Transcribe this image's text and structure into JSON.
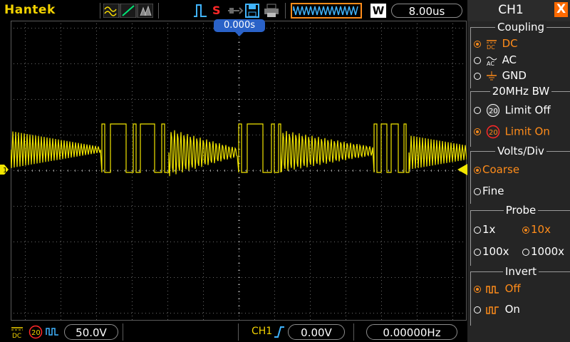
{
  "topbar": {
    "brand": "Hantek",
    "trigger_status": "S",
    "wave_mode_badge": "W",
    "timebase": "8.00us"
  },
  "scope": {
    "trigger_position": "0.000s",
    "channel_marker": "1",
    "trace_color": "#f2e600"
  },
  "bottombar": {
    "coupling_label": "DC",
    "bw_limit_label": "20",
    "volts_div": "50.0V",
    "trigger_source": "CH1",
    "trigger_level": "0.00V",
    "frequency": "0.00000Hz"
  },
  "menu": {
    "title": "CH1",
    "close_label": "X",
    "coupling": {
      "title": "Coupling",
      "options": [
        {
          "label": "DC",
          "selected": true
        },
        {
          "label": "AC",
          "selected": false
        },
        {
          "label": "GND",
          "selected": false
        }
      ]
    },
    "bw": {
      "title": "20MHz BW",
      "options": [
        {
          "label": "Limit Off",
          "selected": false
        },
        {
          "label": "Limit On",
          "selected": true
        }
      ]
    },
    "volts_div": {
      "title": "Volts/Div",
      "options": [
        {
          "label": "Coarse",
          "selected": true
        },
        {
          "label": "Fine",
          "selected": false
        }
      ]
    },
    "probe": {
      "title": "Probe",
      "options": [
        {
          "label": "1x",
          "selected": false
        },
        {
          "label": "10x",
          "selected": true
        },
        {
          "label": "100x",
          "selected": false
        },
        {
          "label": "1000x",
          "selected": false
        }
      ]
    },
    "invert": {
      "title": "Invert",
      "options": [
        {
          "label": "Off",
          "selected": true
        },
        {
          "label": "On",
          "selected": false
        }
      ]
    }
  },
  "colors": {
    "accent_orange": "#ff8c1a",
    "trace_yellow": "#f2e600",
    "marker_blue": "#2a62c8"
  }
}
